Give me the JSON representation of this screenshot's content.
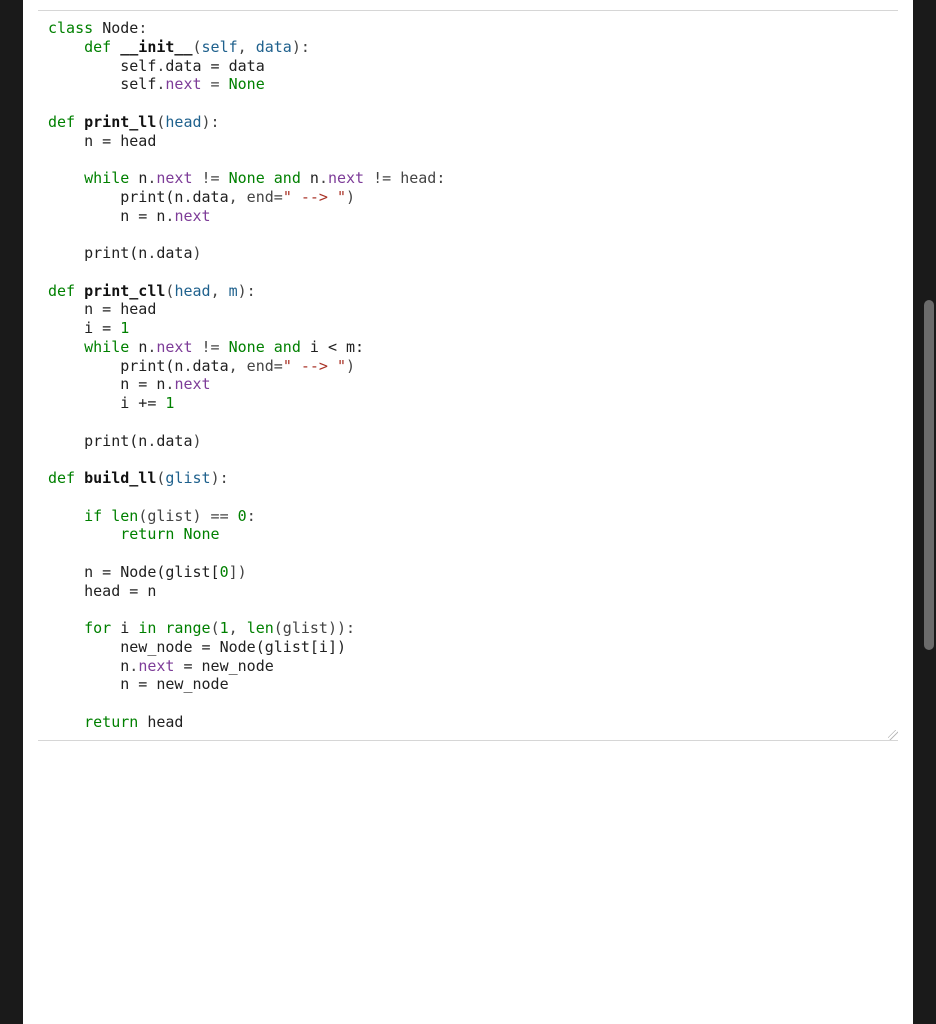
{
  "code": {
    "tokens": [
      [
        {
          "t": "class ",
          "c": "tok-kw"
        },
        {
          "t": "Node",
          "c": "tok-name"
        },
        {
          "t": ":",
          "c": "tok-punct"
        }
      ],
      [
        {
          "t": "    ",
          "c": ""
        },
        {
          "t": "def ",
          "c": "tok-kw"
        },
        {
          "t": "__init__",
          "c": "tok-defname"
        },
        {
          "t": "(",
          "c": "tok-punct"
        },
        {
          "t": "self",
          "c": "tok-param"
        },
        {
          "t": ", ",
          "c": "tok-punct"
        },
        {
          "t": "data",
          "c": "tok-param"
        },
        {
          "t": "):",
          "c": "tok-punct"
        }
      ],
      [
        {
          "t": "        self",
          "c": "tok-name"
        },
        {
          "t": ".",
          "c": "tok-punct"
        },
        {
          "t": "data",
          "c": "tok-name"
        },
        {
          "t": " = data",
          "c": "tok-name"
        }
      ],
      [
        {
          "t": "        self",
          "c": "tok-name"
        },
        {
          "t": ".",
          "c": "tok-punct"
        },
        {
          "t": "next",
          "c": "tok-attr"
        },
        {
          "t": " = ",
          "c": "tok-punct"
        },
        {
          "t": "None",
          "c": "tok-builtin"
        }
      ],
      [],
      [
        {
          "t": "def ",
          "c": "tok-kw"
        },
        {
          "t": "print_ll",
          "c": "tok-defname"
        },
        {
          "t": "(",
          "c": "tok-punct"
        },
        {
          "t": "head",
          "c": "tok-param"
        },
        {
          "t": "):",
          "c": "tok-punct"
        }
      ],
      [
        {
          "t": "    n = head",
          "c": "tok-name"
        }
      ],
      [],
      [
        {
          "t": "    ",
          "c": ""
        },
        {
          "t": "while ",
          "c": "tok-kw"
        },
        {
          "t": "n",
          "c": "tok-name"
        },
        {
          "t": ".",
          "c": "tok-punct"
        },
        {
          "t": "next",
          "c": "tok-attr"
        },
        {
          "t": " != ",
          "c": "tok-punct"
        },
        {
          "t": "None",
          "c": "tok-builtin"
        },
        {
          "t": " and ",
          "c": "tok-kw"
        },
        {
          "t": "n",
          "c": "tok-name"
        },
        {
          "t": ".",
          "c": "tok-punct"
        },
        {
          "t": "next",
          "c": "tok-attr"
        },
        {
          "t": " != head:",
          "c": "tok-punct"
        }
      ],
      [
        {
          "t": "        print(n",
          "c": "tok-name"
        },
        {
          "t": ".",
          "c": "tok-punct"
        },
        {
          "t": "data",
          "c": "tok-name"
        },
        {
          "t": ", end=",
          "c": "tok-punct"
        },
        {
          "t": "\" --> \"",
          "c": "tok-str"
        },
        {
          "t": ")",
          "c": "tok-punct"
        }
      ],
      [
        {
          "t": "        n = n",
          "c": "tok-name"
        },
        {
          "t": ".",
          "c": "tok-punct"
        },
        {
          "t": "next",
          "c": "tok-attr"
        }
      ],
      [],
      [
        {
          "t": "    print(n",
          "c": "tok-name"
        },
        {
          "t": ".",
          "c": "tok-punct"
        },
        {
          "t": "data",
          "c": "tok-name"
        },
        {
          "t": ")",
          "c": "tok-punct"
        }
      ],
      [],
      [
        {
          "t": "def ",
          "c": "tok-kw"
        },
        {
          "t": "print_cll",
          "c": "tok-defname"
        },
        {
          "t": "(",
          "c": "tok-punct"
        },
        {
          "t": "head",
          "c": "tok-param"
        },
        {
          "t": ", ",
          "c": "tok-punct"
        },
        {
          "t": "m",
          "c": "tok-param"
        },
        {
          "t": "):",
          "c": "tok-punct"
        }
      ],
      [
        {
          "t": "    n = head",
          "c": "tok-name"
        }
      ],
      [
        {
          "t": "    i = ",
          "c": "tok-name"
        },
        {
          "t": "1",
          "c": "tok-num"
        }
      ],
      [
        {
          "t": "    ",
          "c": ""
        },
        {
          "t": "while ",
          "c": "tok-kw"
        },
        {
          "t": "n",
          "c": "tok-name"
        },
        {
          "t": ".",
          "c": "tok-punct"
        },
        {
          "t": "next",
          "c": "tok-attr"
        },
        {
          "t": " != ",
          "c": "tok-punct"
        },
        {
          "t": "None",
          "c": "tok-builtin"
        },
        {
          "t": " and ",
          "c": "tok-kw"
        },
        {
          "t": "i < m:",
          "c": "tok-name"
        }
      ],
      [
        {
          "t": "        print(n",
          "c": "tok-name"
        },
        {
          "t": ".",
          "c": "tok-punct"
        },
        {
          "t": "data",
          "c": "tok-name"
        },
        {
          "t": ", end=",
          "c": "tok-punct"
        },
        {
          "t": "\" --> \"",
          "c": "tok-str"
        },
        {
          "t": ")",
          "c": "tok-punct"
        }
      ],
      [
        {
          "t": "        n = n",
          "c": "tok-name"
        },
        {
          "t": ".",
          "c": "tok-punct"
        },
        {
          "t": "next",
          "c": "tok-attr"
        }
      ],
      [
        {
          "t": "        i += ",
          "c": "tok-name"
        },
        {
          "t": "1",
          "c": "tok-num"
        }
      ],
      [],
      [
        {
          "t": "    print(n",
          "c": "tok-name"
        },
        {
          "t": ".",
          "c": "tok-punct"
        },
        {
          "t": "data",
          "c": "tok-name"
        },
        {
          "t": ")",
          "c": "tok-punct"
        }
      ],
      [],
      [
        {
          "t": "def ",
          "c": "tok-kw"
        },
        {
          "t": "build_ll",
          "c": "tok-defname"
        },
        {
          "t": "(",
          "c": "tok-punct"
        },
        {
          "t": "glist",
          "c": "tok-param"
        },
        {
          "t": "):",
          "c": "tok-punct"
        }
      ],
      [],
      [
        {
          "t": "    ",
          "c": ""
        },
        {
          "t": "if ",
          "c": "tok-kw"
        },
        {
          "t": "len",
          "c": "tok-builtin"
        },
        {
          "t": "(glist) == ",
          "c": "tok-punct"
        },
        {
          "t": "0",
          "c": "tok-num"
        },
        {
          "t": ":",
          "c": "tok-punct"
        }
      ],
      [
        {
          "t": "        ",
          "c": ""
        },
        {
          "t": "return ",
          "c": "tok-kw"
        },
        {
          "t": "None",
          "c": "tok-builtin"
        }
      ],
      [],
      [
        {
          "t": "    n = Node(glist[",
          "c": "tok-name"
        },
        {
          "t": "0",
          "c": "tok-num"
        },
        {
          "t": "])",
          "c": "tok-punct"
        }
      ],
      [
        {
          "t": "    head = n",
          "c": "tok-name"
        }
      ],
      [],
      [
        {
          "t": "    ",
          "c": ""
        },
        {
          "t": "for ",
          "c": "tok-kw"
        },
        {
          "t": "i ",
          "c": "tok-name"
        },
        {
          "t": "in ",
          "c": "tok-kw"
        },
        {
          "t": "range",
          "c": "tok-builtin"
        },
        {
          "t": "(",
          "c": "tok-punct"
        },
        {
          "t": "1",
          "c": "tok-num"
        },
        {
          "t": ", ",
          "c": "tok-punct"
        },
        {
          "t": "len",
          "c": "tok-builtin"
        },
        {
          "t": "(glist)):",
          "c": "tok-punct"
        }
      ],
      [
        {
          "t": "        new_node = Node(glist[i])",
          "c": "tok-name"
        }
      ],
      [
        {
          "t": "        n",
          "c": "tok-name"
        },
        {
          "t": ".",
          "c": "tok-punct"
        },
        {
          "t": "next",
          "c": "tok-attr"
        },
        {
          "t": " = new_node",
          "c": "tok-name"
        }
      ],
      [
        {
          "t": "        n = new_node",
          "c": "tok-name"
        }
      ],
      [],
      [
        {
          "t": "    ",
          "c": ""
        },
        {
          "t": "return ",
          "c": "tok-kw"
        },
        {
          "t": "head",
          "c": "tok-name"
        }
      ]
    ]
  }
}
